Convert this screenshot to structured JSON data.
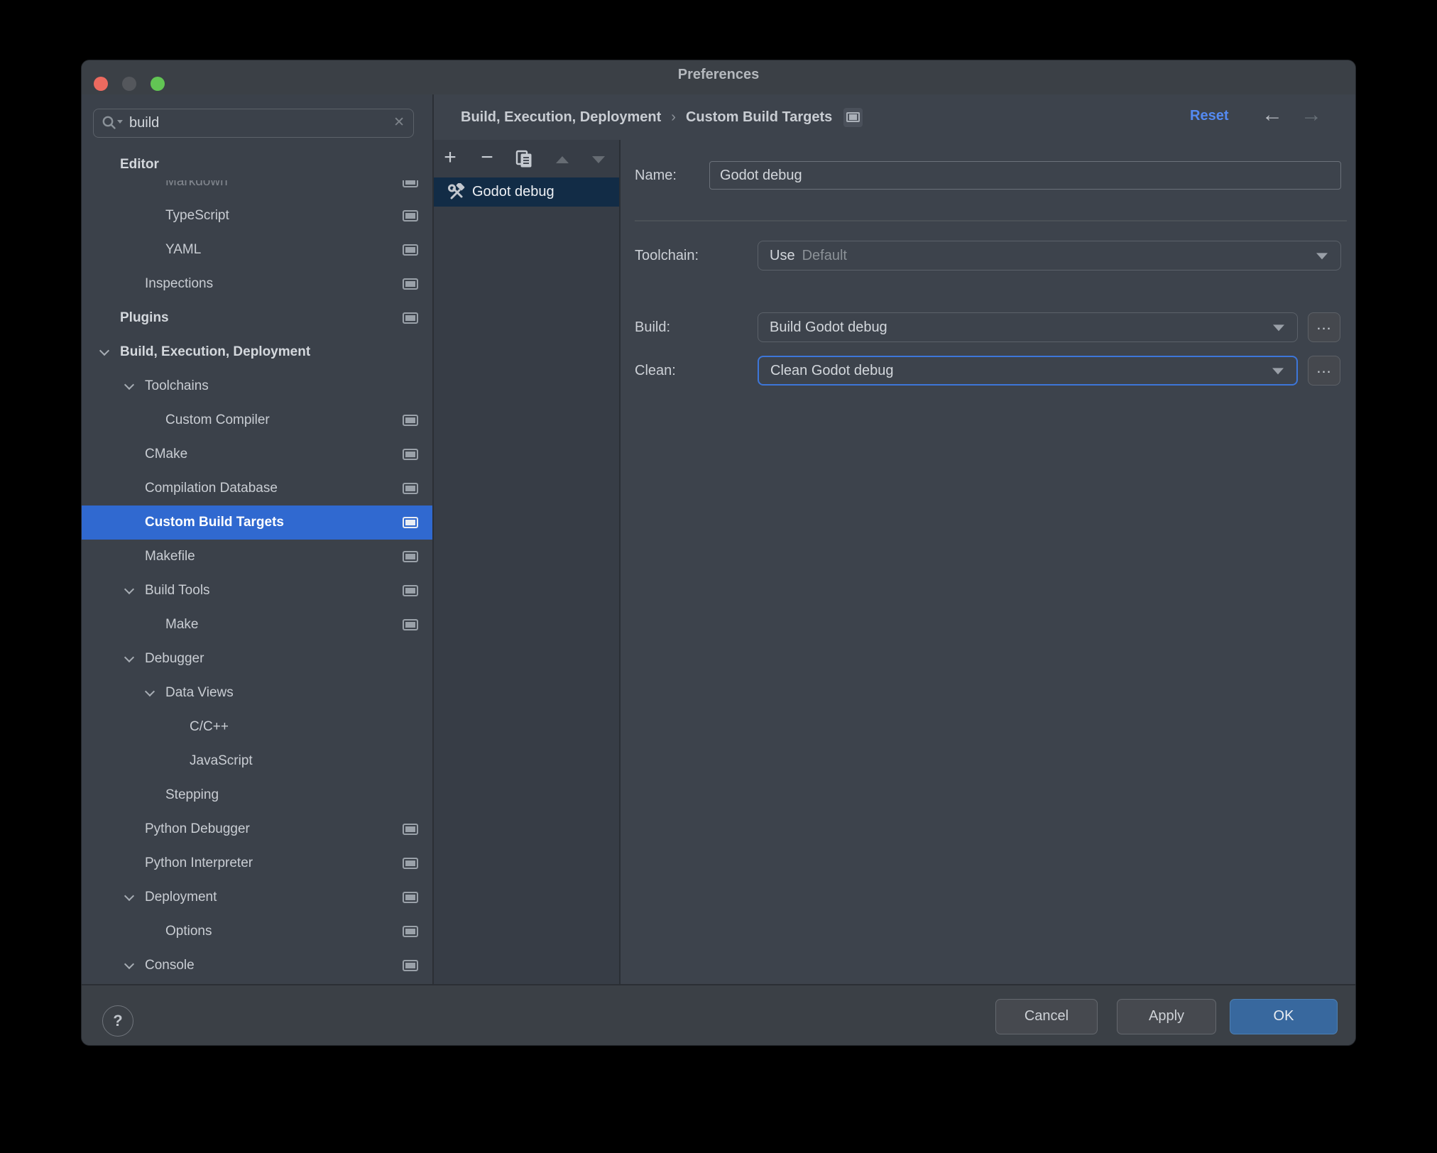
{
  "colors": {
    "accent_blue": "#3069d0",
    "list_selection": "#122c46",
    "link_blue": "#548af2",
    "ok_button": "#38689e",
    "ok_border": "#4c80b4",
    "focus_ring": "#3d76d9",
    "traffic_red": "#ed6a5f",
    "traffic_grey": "#54575c",
    "traffic_green": "#62c554"
  },
  "window": {
    "title": "Preferences"
  },
  "search": {
    "value": "build"
  },
  "icons": {
    "back": "←",
    "forward": "→",
    "clear": "✕",
    "help": "?",
    "more": "...",
    "add": "+",
    "remove": "−"
  },
  "sidebar": {
    "items": [
      {
        "label": "Editor",
        "level": 0,
        "bold": true,
        "header": true
      },
      {
        "label": "Markdown",
        "level": 2,
        "icon": true,
        "faded": true
      },
      {
        "label": "TypeScript",
        "level": 2,
        "icon": true
      },
      {
        "label": "YAML",
        "level": 2,
        "icon": true
      },
      {
        "label": "Inspections",
        "level": 1,
        "icon": true
      },
      {
        "label": "Plugins",
        "level": 0,
        "bold": true,
        "icon": true
      },
      {
        "label": "Build, Execution, Deployment",
        "level": 0,
        "bold": true,
        "chevron": true
      },
      {
        "label": "Toolchains",
        "level": 1,
        "chevron": true
      },
      {
        "label": "Custom Compiler",
        "level": 2,
        "icon": true
      },
      {
        "label": "CMake",
        "level": 1,
        "icon": true
      },
      {
        "label": "Compilation Database",
        "level": 1,
        "icon": true
      },
      {
        "label": "Custom Build Targets",
        "level": 1,
        "icon": true,
        "selected": true
      },
      {
        "label": "Makefile",
        "level": 1,
        "icon": true
      },
      {
        "label": "Build Tools",
        "level": 1,
        "chevron": true,
        "icon": true
      },
      {
        "label": "Make",
        "level": 2,
        "icon": true
      },
      {
        "label": "Debugger",
        "level": 1,
        "chevron": true
      },
      {
        "label": "Data Views",
        "level": 2,
        "chevron": true
      },
      {
        "label": "C/C++",
        "level": 3
      },
      {
        "label": "JavaScript",
        "level": 3
      },
      {
        "label": "Stepping",
        "level": 2
      },
      {
        "label": "Python Debugger",
        "level": 1,
        "icon": true
      },
      {
        "label": "Python Interpreter",
        "level": 1,
        "icon": true
      },
      {
        "label": "Deployment",
        "level": 1,
        "chevron": true,
        "icon": true
      },
      {
        "label": "Options",
        "level": 2,
        "icon": true
      },
      {
        "label": "Console",
        "level": 1,
        "chevron": true,
        "icon": true
      }
    ]
  },
  "breadcrumb": {
    "path": [
      "Build, Execution, Deployment",
      "Custom Build Targets"
    ],
    "separator": "›"
  },
  "header": {
    "reset_label": "Reset"
  },
  "targets": {
    "items": [
      {
        "label": "Godot debug",
        "selected": true
      }
    ]
  },
  "form": {
    "name_label": "Name:",
    "name_value": "Godot debug",
    "toolchain_label": "Toolchain:",
    "toolchain_use": "Use",
    "toolchain_value": "Default",
    "build_label": "Build:",
    "build_value": "Build Godot debug",
    "clean_label": "Clean:",
    "clean_value": "Clean Godot debug"
  },
  "footer": {
    "cancel_label": "Cancel",
    "apply_label": "Apply",
    "ok_label": "OK"
  }
}
